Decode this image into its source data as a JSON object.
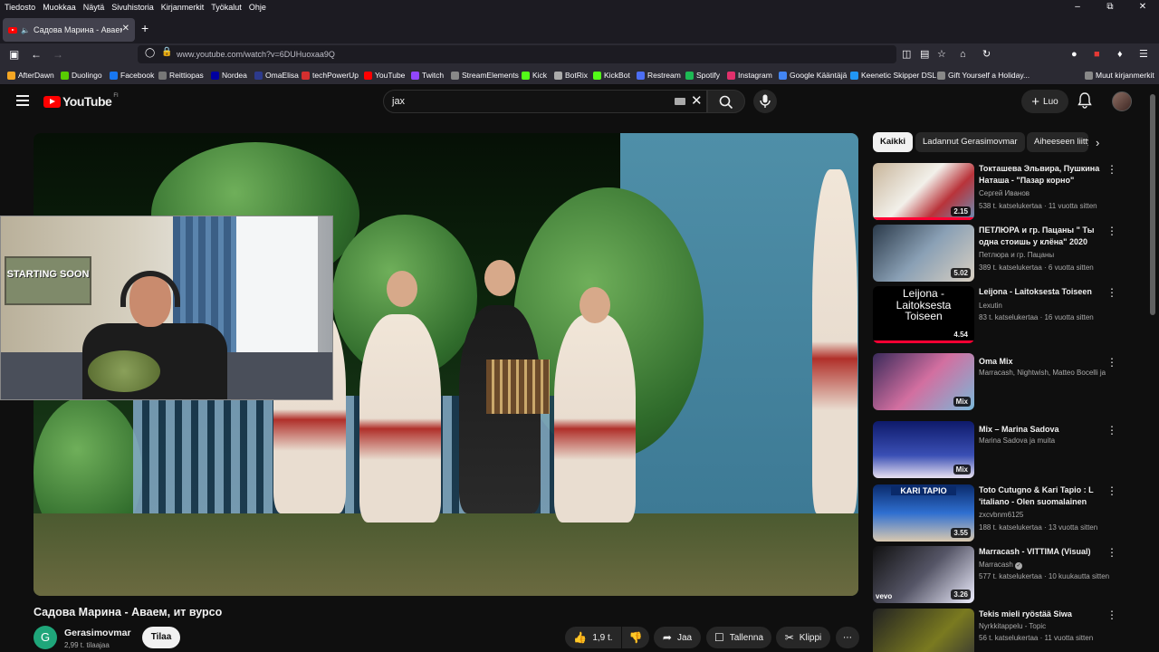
{
  "menubar": [
    "Tiedosto",
    "Muokkaa",
    "Näytä",
    "Sivuhistoria",
    "Kirjanmerkit",
    "Työkalut",
    "Ohje"
  ],
  "tab": {
    "title": "Садова Марина - Аваем, ит вурсо"
  },
  "navbar": {
    "url": "www.youtube.com/watch?v=6DUHuoxaa9Q"
  },
  "bookmarks": [
    {
      "label": "AfterDawn",
      "color": "#f5a623"
    },
    {
      "label": "Duolingo",
      "color": "#58cc02"
    },
    {
      "label": "Facebook",
      "color": "#1877f2"
    },
    {
      "label": "Reittiopas",
      "color": "#777777"
    },
    {
      "label": "Nordea",
      "color": "#0000a0"
    },
    {
      "label": "OmaElisa",
      "color": "#2d3a8c"
    },
    {
      "label": "techPowerUp",
      "color": "#d32f2f"
    },
    {
      "label": "YouTube",
      "color": "#ff0000"
    },
    {
      "label": "Twitch",
      "color": "#9146ff"
    },
    {
      "label": "StreamElements",
      "color": "#888888"
    },
    {
      "label": "Kick",
      "color": "#53fc18"
    },
    {
      "label": "BotRix",
      "color": "#aaaaaa"
    },
    {
      "label": "KickBot",
      "color": "#53fc18"
    },
    {
      "label": "Restream",
      "color": "#4c6ef5"
    },
    {
      "label": "Spotify",
      "color": "#1db954"
    },
    {
      "label": "Instagram",
      "color": "#e1306c"
    },
    {
      "label": "Google Kääntäjä",
      "color": "#4285f4"
    },
    {
      "label": "Keenetic Skipper DSL",
      "color": "#2196f3"
    },
    {
      "label": "Gift Yourself a Holiday...",
      "color": "#888888"
    },
    {
      "label": "Muut kirjanmerkit",
      "color": "#888888"
    }
  ],
  "youtube": {
    "logo_text": "YouTube",
    "region": "FI",
    "search_value": "jax",
    "create_label": "Luo"
  },
  "webcam": {
    "poster_text": "STARTING SOON"
  },
  "video": {
    "title": "Садова Марина - Аваем, ит вурсо",
    "channel": "Gerasimovmar",
    "channel_initial": "G",
    "subscribers": "2,99 t. tilaajaa",
    "subscribe_label": "Tilaa",
    "likes": "1,9 t.",
    "share_label": "Jaa",
    "save_label": "Tallenna",
    "clip_label": "Klippi"
  },
  "chips": [
    "Kaikki",
    "Ladannut Gerasimovmar",
    "Aiheeseen liittyvät"
  ],
  "recommendations": [
    {
      "title": "Токташева Эльвира, Пушкина Наташа - \"Пазар корно\"",
      "channel": "Сергей Иванов",
      "meta": "538 t. katselukertaa · 11 vuotta sitten",
      "duration": "2.15",
      "thumb": "linear-gradient(135deg,#c8b59a,#f2f0ea 45%,#b9333a 70%,#6a8fb5)",
      "watched": true
    },
    {
      "title": "ПЕТЛЮРА и гр. Пацаны \" Ты одна стоишь у клёна\" 2020",
      "channel": "Петлюра и гр. Пацаны",
      "meta": "389 t. katselukertaa · 6 vuotta sitten",
      "duration": "5.02",
      "thumb": "linear-gradient(135deg,#2b3a4a,#8aa0b5 50%,#d9d0c2)",
      "watched": false
    },
    {
      "title": "Leijona - Laitoksesta Toiseen",
      "channel": "Lexutin",
      "meta": "83 t. katselukertaa · 16 vuotta sitten",
      "duration": "4.54",
      "thumb": "#000000",
      "thumb_text": "Leijona - Laitoksesta Toiseen",
      "watched": true
    },
    {
      "title": "Oma Mix",
      "channel": "Marracash, Nightwish, Matteo Bocelli ja ...",
      "meta": "",
      "duration": "Mix",
      "thumb": "linear-gradient(135deg,#3a2a5a,#d26fa0 50%,#7ab8d9)",
      "watched": false
    },
    {
      "title": "Mix – Marina Sadova",
      "channel": "Marina Sadova ja muita",
      "meta": "",
      "duration": "Mix",
      "thumb": "linear-gradient(180deg,#0e1a6a,#3a4fb5 60%,#e8e0f0)",
      "watched": false
    },
    {
      "title": "Toto Cutugno & Kari Tapio : L 'italiano - Olen suomalainen",
      "channel": "zxcvbnm6125",
      "meta": "188 t. katselukertaa · 13 vuotta sitten",
      "duration": "3.55",
      "thumb": "linear-gradient(180deg,#0a2a6a,#2f6fd0 50%,#d9c9b0)",
      "thumb_text": "KARI TAPIO",
      "watched": false
    },
    {
      "title": "Marracash - VITTIMA (Visual)",
      "channel": "Marracash",
      "meta": "577 t. katselukertaa · 10 kuukautta sitten",
      "duration": "3.26",
      "thumb": "linear-gradient(135deg,#111,#556 50%,#eef)",
      "verified": true,
      "watched": false
    },
    {
      "title": "Tekis mieli ryöstää Siwa",
      "channel": "Nyrkkitappelu - Topic",
      "meta": "56 t. katselukertaa · 11 vuotta sitten",
      "duration": "",
      "thumb": "linear-gradient(135deg,#222,#7a7a20 60%,#333)",
      "watched": false
    }
  ]
}
